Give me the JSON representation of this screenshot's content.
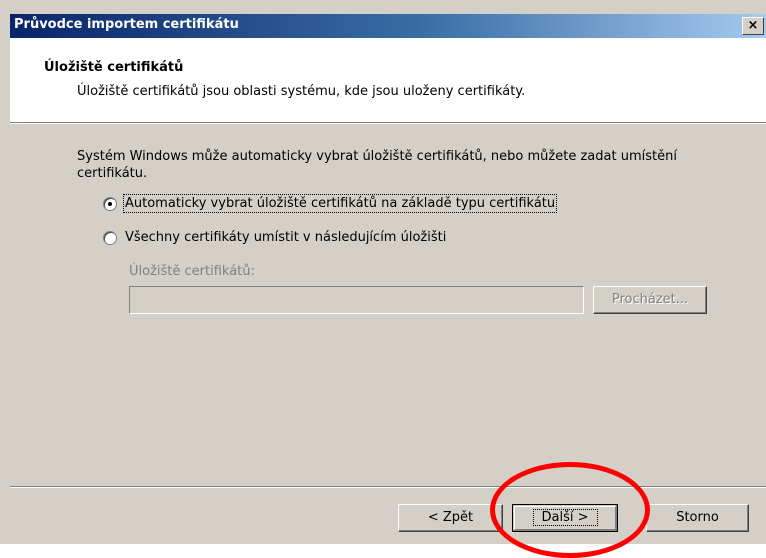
{
  "window": {
    "title": "Průvodce importem certifikátu",
    "close_glyph": "×"
  },
  "header": {
    "title": "Úložiště certifikátů",
    "description": "Úložiště certifikátů jsou oblasti systému, kde jsou uloženy certifikáty."
  },
  "body": {
    "intro": "Systém Windows může automaticky vybrat úložiště certifikátů, nebo můžete zadat umístění certifikátu.",
    "options": [
      {
        "label": "Automaticky vybrat úložiště certifikátů na základě typu certifikátu",
        "selected": true
      },
      {
        "label": "Všechny certifikáty umístit v následujícím úložišti",
        "selected": false
      }
    ],
    "store_label": "Úložiště certifikátů:",
    "store_value": "",
    "browse_label": "Procházet..."
  },
  "footer": {
    "back_label": "< Zpět",
    "next_label": "Další >",
    "cancel_label": "Storno"
  },
  "colors": {
    "dialog_bg": "#d4d0c8",
    "title_bar": "#0a246a",
    "annotation": "#ff0000"
  }
}
